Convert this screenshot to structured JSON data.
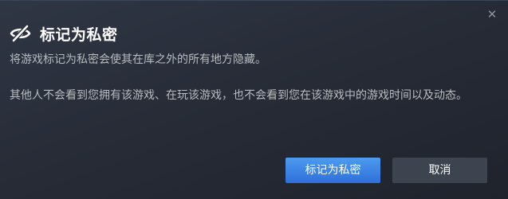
{
  "dialog": {
    "title": "标记为私密",
    "description_1": "将游戏标记为私密会使其在库之外的所有地方隐藏。",
    "description_2": "其他人不会看到您拥有该游戏、在玩该游戏，也不会看到您在该游戏中的游戏时间以及动态。",
    "close_glyph": "✕",
    "title_icon": "eye-slash-icon"
  },
  "buttons": {
    "confirm_label": "标记为私密",
    "cancel_label": "取消"
  },
  "colors": {
    "accent_button": "#3b82e6",
    "secondary_button": "#3d4450",
    "title_text": "#ffffff",
    "body_text": "#b8bcbf"
  }
}
